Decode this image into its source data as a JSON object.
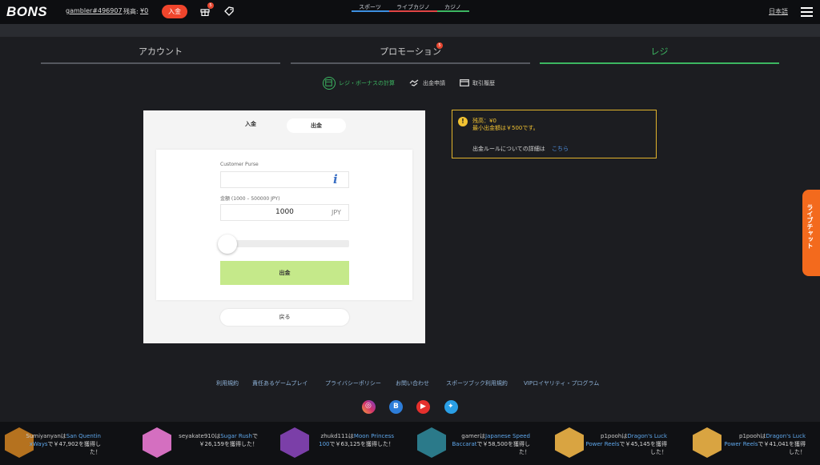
{
  "header": {
    "logo": "BONS",
    "username": "gambler#496907",
    "balance_label": "残高:",
    "balance_value": "¥0",
    "deposit_button": "入金",
    "gift_badge": "5",
    "language": "日本語"
  },
  "product_tabs": [
    {
      "label": "スポーツ",
      "color": "#3d8fe0"
    },
    {
      "label": "ライブカジノ",
      "color": "#e04545"
    },
    {
      "label": "カジノ",
      "color": "#3cb661"
    }
  ],
  "main_tabs": [
    {
      "label": "アカウント",
      "active": false
    },
    {
      "label": "プロモーション",
      "active": false,
      "badge": "5"
    },
    {
      "label": "レジ",
      "active": true
    }
  ],
  "accent_green": "#3cb661",
  "sub_actions": [
    {
      "label": "レジ・ボーナスの計算",
      "icon": "calculator-icon",
      "active": true
    },
    {
      "label": "出金申請",
      "icon": "handshake-icon",
      "active": false
    },
    {
      "label": "取引履歴",
      "icon": "card-icon",
      "active": false
    }
  ],
  "cashier": {
    "tab_deposit": "入金",
    "tab_withdraw": "出金",
    "purse_label": "Customer Purse",
    "purse_value": "",
    "amount_label": "金額 (1000 – 500000 JPY)",
    "amount_value": "1000",
    "amount_unit": "JPY",
    "slider_level": 0,
    "submit_label": "出金",
    "back_label": "戻る"
  },
  "info": {
    "balance_line": "残高：¥0",
    "min_line": "最小出金額は￥500です。",
    "rules_text": "出金ルールについての詳細は",
    "rules_link": "こちら"
  },
  "live_chat": "ライブチャット",
  "footer": {
    "links": [
      "利用規約",
      "責任あるゲームプレイ",
      "プライバシーポリシー",
      "お問い合わせ",
      "スポーツブック利用規約",
      "VIPロイヤリティ・プログラム"
    ],
    "social": [
      "instagram-icon",
      "blog-icon",
      "youtube-icon",
      "twitter-icon"
    ]
  },
  "ticker": [
    {
      "user": "Sumiyanyan",
      "mid": "は",
      "game": "San Quentin xWays",
      "amount": "で￥47,902を獲得した！",
      "color": "#b5721f"
    },
    {
      "user": "seyakate910",
      "mid": "は",
      "game": "Sugar Rush",
      "amount": "で￥26,159を獲得した！",
      "color": "#d46fc0"
    },
    {
      "user": "zhukd111",
      "mid": "は",
      "game": "Moon Princess 100",
      "amount": "で￥63,125を獲得した！",
      "color": "#7b3fa8"
    },
    {
      "user": "gamer",
      "mid": "は",
      "game": "Japanese Speed Baccarat",
      "amount": "で￥58,500を獲得した！",
      "color": "#2b7a8a"
    },
    {
      "user": "p1pooh",
      "mid": "は",
      "game": "Dragon's Luck Power Reels",
      "amount": "で￥45,145を獲得した！",
      "color": "#d9a441"
    },
    {
      "user": "p1pooh",
      "mid": "は",
      "game": "Dragon's Luck Power Reels",
      "amount": "で￥41,041を獲得した！",
      "color": "#d9a441"
    }
  ]
}
